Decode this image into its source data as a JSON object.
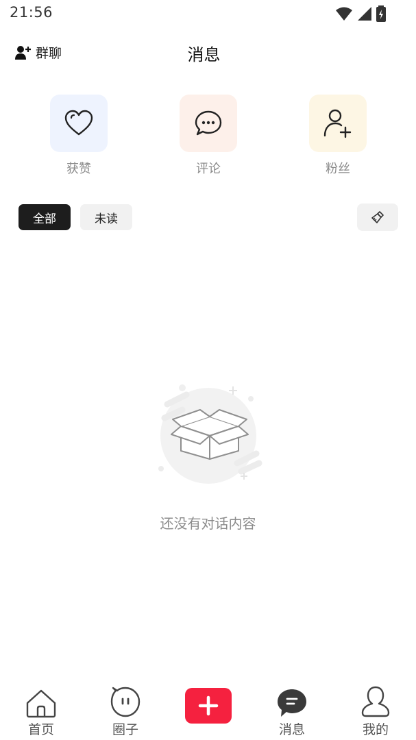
{
  "status_bar": {
    "time": "21:56",
    "icons": [
      "wifi-icon",
      "signal-icon",
      "battery-charging-icon"
    ]
  },
  "header": {
    "group_chat_label": "群聊",
    "title": "消息"
  },
  "categories": [
    {
      "label": "获赞",
      "icon": "heart-icon",
      "bg": "#eef3fe"
    },
    {
      "label": "评论",
      "icon": "comment-bubble-icon",
      "bg": "#fdf0ea"
    },
    {
      "label": "粉丝",
      "icon": "add-person-icon",
      "bg": "#fdf6e4"
    }
  ],
  "filters": {
    "all": "全部",
    "unread": "未读",
    "selected": "全部"
  },
  "empty_state": {
    "message": "还没有对话内容",
    "icon": "empty-box-icon"
  },
  "tabbar": {
    "items": [
      {
        "label": "首页",
        "icon": "home-icon"
      },
      {
        "label": "圈子",
        "icon": "circle-face-icon"
      },
      {
        "label": "",
        "icon": "plus-icon"
      },
      {
        "label": "消息",
        "icon": "message-bubble-icon"
      },
      {
        "label": "我的",
        "icon": "profile-icon"
      }
    ],
    "current": "消息",
    "accent": "#f5213f"
  }
}
